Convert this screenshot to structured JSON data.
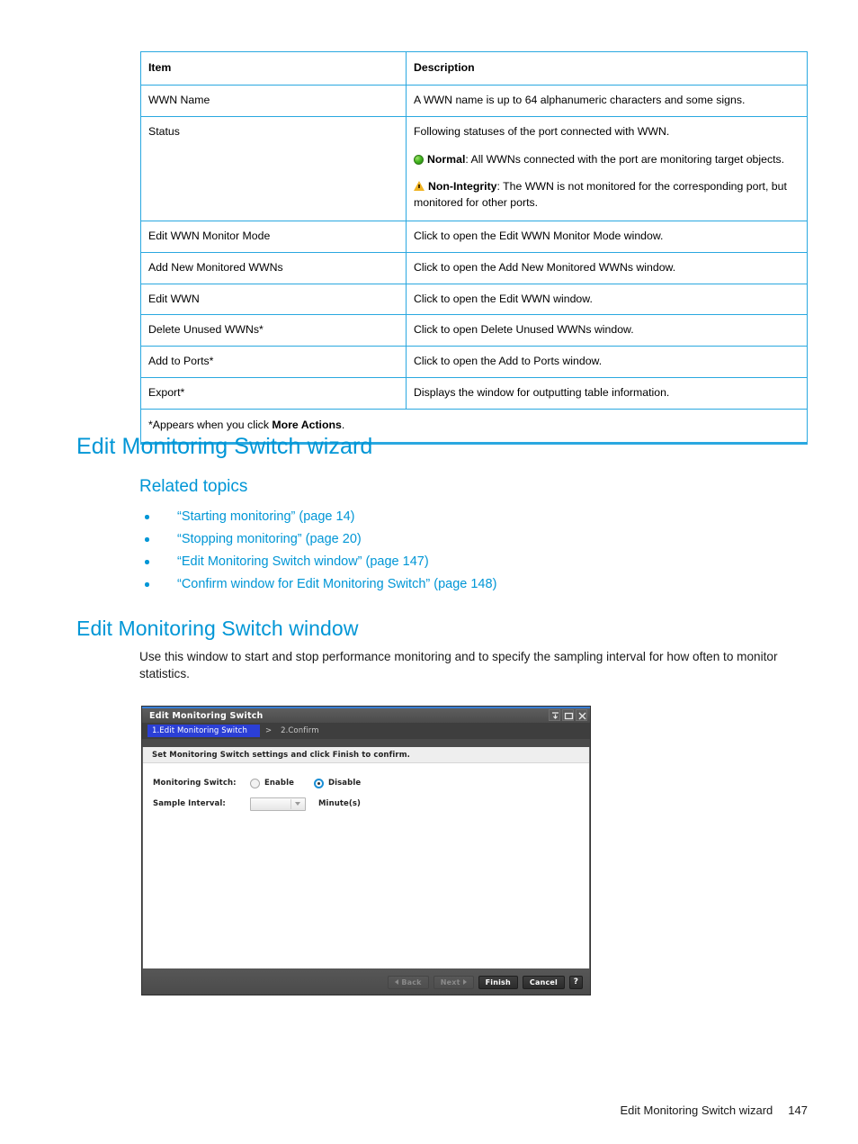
{
  "table": {
    "headers": [
      "Item",
      "Description"
    ],
    "rows": [
      {
        "item": "WWN Name",
        "desc": "A WWN name is up to 64 alphanumeric characters and some signs."
      },
      {
        "item": "Status",
        "desc_intro": "Following statuses of the port connected with WWN.",
        "status_normal_icon": "green-circle-icon",
        "status_normal_label": "Normal",
        "status_normal_text": ": All WWNs connected with the port are monitoring target objects.",
        "status_warning_icon": "warning-triangle-icon",
        "status_warning_label": "Non-Integrity",
        "status_warning_text": ": The WWN is not monitored for the corresponding port, but monitored for other ports."
      },
      {
        "item": "Edit WWN Monitor Mode",
        "desc": "Click to open the Edit WWN Monitor Mode window."
      },
      {
        "item": "Add New Monitored WWNs",
        "desc": "Click to open the Add New Monitored WWNs window."
      },
      {
        "item": "Edit WWN",
        "desc": "Click to open the Edit WWN window."
      },
      {
        "item": "Delete Unused WWNs*",
        "desc": "Click to open Delete Unused WWNs window."
      },
      {
        "item": "Add to Ports*",
        "desc": "Click to open the Add to Ports window."
      },
      {
        "item": "Export*",
        "desc": "Displays the window for outputting table information."
      }
    ],
    "footnote_prefix": "*Appears when you click ",
    "footnote_bold": "More Actions",
    "footnote_suffix": "."
  },
  "sections": {
    "wizard_heading": "Edit Monitoring Switch wizard",
    "related_topics_heading": "Related topics",
    "related_topics": [
      "“Starting monitoring” (page 14)",
      "“Stopping monitoring” (page 20)",
      "“Edit Monitoring Switch window” (page 147)",
      "“Confirm window for Edit Monitoring Switch” (page 148)"
    ],
    "window_heading": "Edit Monitoring Switch window",
    "window_paragraph": "Use this window to start and stop performance monitoring and to specify the sampling interval for how often to monitor statistics."
  },
  "dialog": {
    "title": "Edit Monitoring Switch",
    "window_buttons": [
      "collapse-icon",
      "maximize-icon",
      "close-icon"
    ],
    "steps": {
      "step1": "1.Edit Monitoring Switch",
      "separator": ">",
      "step2": "2.Confirm"
    },
    "instruction": "Set Monitoring Switch settings and click Finish to confirm.",
    "fields": {
      "monitoring_switch_label": "Monitoring Switch:",
      "enable_label": "Enable",
      "disable_label": "Disable",
      "selected_option": "Disable",
      "sample_interval_label": "Sample Interval:",
      "sample_interval_value": "",
      "sample_interval_unit": "Minute(s)"
    },
    "buttons": {
      "back": "Back",
      "next": "Next",
      "finish": "Finish",
      "cancel": "Cancel",
      "help": "?"
    }
  },
  "footer": {
    "text": "Edit Monitoring Switch wizard",
    "page": "147"
  },
  "colors": {
    "accent_blue": "#0096d6",
    "table_border": "#2aa8e0",
    "step_active": "#2b3fd6",
    "status_normal": "#46b822",
    "status_warning": "#f0b323"
  }
}
